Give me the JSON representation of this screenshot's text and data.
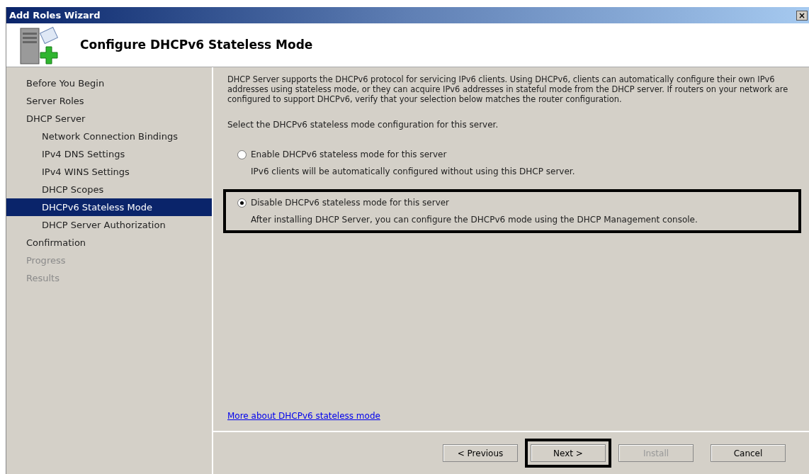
{
  "window": {
    "title": "Add Roles Wizard",
    "close": "×"
  },
  "header": {
    "title": "Configure DHCPv6 Stateless Mode"
  },
  "sidebar": {
    "items": [
      {
        "label": "Before You Begin",
        "selected": false,
        "disabled": false
      },
      {
        "label": "Server Roles",
        "selected": false,
        "disabled": false
      },
      {
        "label": "DHCP Server",
        "selected": false,
        "disabled": false,
        "children": [
          {
            "label": "Network Connection Bindings",
            "selected": false,
            "disabled": false
          },
          {
            "label": "IPv4 DNS Settings",
            "selected": false,
            "disabled": false
          },
          {
            "label": "IPv4 WINS Settings",
            "selected": false,
            "disabled": false
          },
          {
            "label": "DHCP Scopes",
            "selected": false,
            "disabled": false
          },
          {
            "label": "DHCPv6 Stateless Mode",
            "selected": true,
            "disabled": false
          },
          {
            "label": "DHCP Server Authorization",
            "selected": false,
            "disabled": false
          }
        ]
      },
      {
        "label": "Confirmation",
        "selected": false,
        "disabled": false
      },
      {
        "label": "Progress",
        "selected": false,
        "disabled": true
      },
      {
        "label": "Results",
        "selected": false,
        "disabled": true
      }
    ]
  },
  "content": {
    "intro": "DHCP Server supports the DHCPv6 protocol for servicing IPv6 clients. Using DHCPv6, clients can automatically configure their own IPv6 addresses using stateless mode, or they can acquire IPv6 addresses in stateful mode from the DHCP server. If routers on your network are configured to support DHCPv6, verify that your selection below matches the router configuration.",
    "prompt": "Select the DHCPv6 stateless mode configuration for this server.",
    "options": [
      {
        "label": "Enable DHCPv6 stateless mode for this server",
        "description": "IPv6 clients will be automatically configured without using this DHCP server.",
        "selected": false,
        "outlined": false
      },
      {
        "label": "Disable DHCPv6 stateless mode for this server",
        "description": "After installing DHCP Server, you can configure the DHCPv6 mode using the DHCP Management console.",
        "selected": true,
        "outlined": true
      }
    ],
    "link": "More about DHCPv6 stateless mode"
  },
  "buttons": [
    {
      "label": "< Previous",
      "disabled": false,
      "outlined": false
    },
    {
      "label": "Next >",
      "disabled": false,
      "outlined": true
    },
    {
      "label": "Install",
      "disabled": true,
      "outlined": false
    },
    {
      "label": "Cancel",
      "disabled": false,
      "outlined": false
    }
  ]
}
